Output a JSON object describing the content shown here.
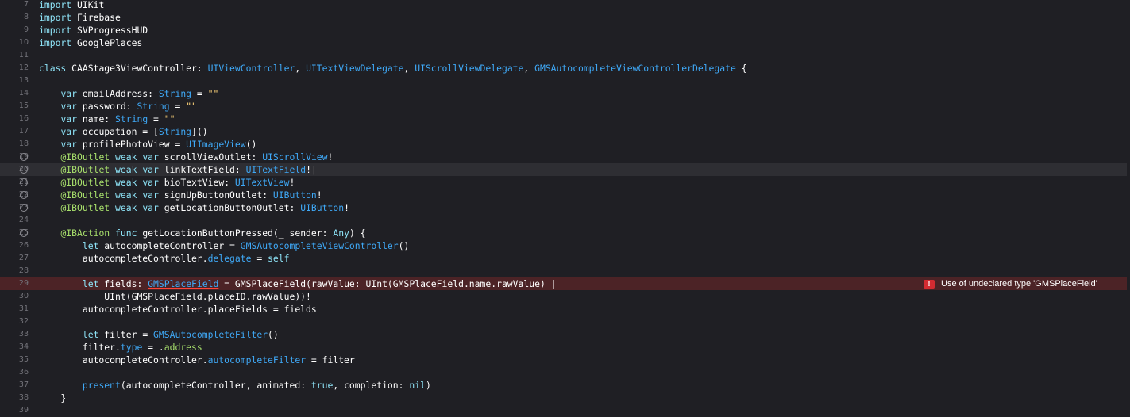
{
  "editor": {
    "lines": [
      {
        "num": "7",
        "tokens": [
          {
            "t": "keyword",
            "v": "import"
          },
          {
            "t": "plain",
            "v": " UIKit"
          }
        ]
      },
      {
        "num": "8",
        "tokens": [
          {
            "t": "keyword",
            "v": "import"
          },
          {
            "t": "plain",
            "v": " Firebase"
          }
        ]
      },
      {
        "num": "9",
        "tokens": [
          {
            "t": "keyword",
            "v": "import"
          },
          {
            "t": "plain",
            "v": " SVProgressHUD"
          }
        ]
      },
      {
        "num": "10",
        "tokens": [
          {
            "t": "keyword",
            "v": "import"
          },
          {
            "t": "plain",
            "v": " GooglePlaces"
          }
        ]
      },
      {
        "num": "11",
        "tokens": []
      },
      {
        "num": "12",
        "tokens": [
          {
            "t": "keyword",
            "v": "class"
          },
          {
            "t": "plain",
            "v": " CAAStage3ViewController: "
          },
          {
            "t": "type",
            "v": "UIViewController"
          },
          {
            "t": "plain",
            "v": ", "
          },
          {
            "t": "type",
            "v": "UITextViewDelegate"
          },
          {
            "t": "plain",
            "v": ", "
          },
          {
            "t": "type",
            "v": "UIScrollViewDelegate"
          },
          {
            "t": "plain",
            "v": ", "
          },
          {
            "t": "type",
            "v": "GMSAutocompleteViewControllerDelegate"
          },
          {
            "t": "plain",
            "v": " {"
          }
        ]
      },
      {
        "num": "13",
        "tokens": []
      },
      {
        "num": "14",
        "tokens": [
          {
            "t": "plain",
            "v": "    "
          },
          {
            "t": "keyword",
            "v": "var"
          },
          {
            "t": "plain",
            "v": " emailAddress: "
          },
          {
            "t": "type",
            "v": "String"
          },
          {
            "t": "plain",
            "v": " = "
          },
          {
            "t": "string",
            "v": "\"\""
          }
        ]
      },
      {
        "num": "15",
        "tokens": [
          {
            "t": "plain",
            "v": "    "
          },
          {
            "t": "keyword",
            "v": "var"
          },
          {
            "t": "plain",
            "v": " password: "
          },
          {
            "t": "type",
            "v": "String"
          },
          {
            "t": "plain",
            "v": " = "
          },
          {
            "t": "string",
            "v": "\"\""
          }
        ]
      },
      {
        "num": "16",
        "tokens": [
          {
            "t": "plain",
            "v": "    "
          },
          {
            "t": "keyword",
            "v": "var"
          },
          {
            "t": "plain",
            "v": " name: "
          },
          {
            "t": "type",
            "v": "String"
          },
          {
            "t": "plain",
            "v": " = "
          },
          {
            "t": "string",
            "v": "\"\""
          }
        ]
      },
      {
        "num": "17",
        "tokens": [
          {
            "t": "plain",
            "v": "    "
          },
          {
            "t": "keyword",
            "v": "var"
          },
          {
            "t": "plain",
            "v": " occupation = ["
          },
          {
            "t": "type",
            "v": "String"
          },
          {
            "t": "plain",
            "v": "]()"
          }
        ]
      },
      {
        "num": "18",
        "tokens": [
          {
            "t": "plain",
            "v": "    "
          },
          {
            "t": "keyword",
            "v": "var"
          },
          {
            "t": "plain",
            "v": " profilePhotoView = "
          },
          {
            "t": "type",
            "v": "UIImageView"
          },
          {
            "t": "plain",
            "v": "()"
          }
        ]
      },
      {
        "num": "19",
        "marker": true,
        "tokens": [
          {
            "t": "plain",
            "v": "    "
          },
          {
            "t": "attr",
            "v": "@IBOutlet"
          },
          {
            "t": "plain",
            "v": " "
          },
          {
            "t": "keyword",
            "v": "weak"
          },
          {
            "t": "plain",
            "v": " "
          },
          {
            "t": "keyword",
            "v": "var"
          },
          {
            "t": "plain",
            "v": " scrollViewOutlet: "
          },
          {
            "t": "type",
            "v": "UIScrollView"
          },
          {
            "t": "plain",
            "v": "!"
          }
        ]
      },
      {
        "num": "20",
        "marker": true,
        "current": true,
        "tokens": [
          {
            "t": "plain",
            "v": "    "
          },
          {
            "t": "attr",
            "v": "@IBOutlet"
          },
          {
            "t": "plain",
            "v": " "
          },
          {
            "t": "keyword",
            "v": "weak"
          },
          {
            "t": "plain",
            "v": " "
          },
          {
            "t": "keyword",
            "v": "var"
          },
          {
            "t": "plain",
            "v": " linkTextField: "
          },
          {
            "t": "type",
            "v": "UITextField"
          },
          {
            "t": "plain",
            "v": "!"
          },
          {
            "t": "cursor",
            "v": "|"
          }
        ]
      },
      {
        "num": "21",
        "marker": true,
        "tokens": [
          {
            "t": "plain",
            "v": "    "
          },
          {
            "t": "attr",
            "v": "@IBOutlet"
          },
          {
            "t": "plain",
            "v": " "
          },
          {
            "t": "keyword",
            "v": "weak"
          },
          {
            "t": "plain",
            "v": " "
          },
          {
            "t": "keyword",
            "v": "var"
          },
          {
            "t": "plain",
            "v": " bioTextView: "
          },
          {
            "t": "type",
            "v": "UITextView"
          },
          {
            "t": "plain",
            "v": "!"
          }
        ]
      },
      {
        "num": "22",
        "marker": true,
        "tokens": [
          {
            "t": "plain",
            "v": "    "
          },
          {
            "t": "attr",
            "v": "@IBOutlet"
          },
          {
            "t": "plain",
            "v": " "
          },
          {
            "t": "keyword",
            "v": "weak"
          },
          {
            "t": "plain",
            "v": " "
          },
          {
            "t": "keyword",
            "v": "var"
          },
          {
            "t": "plain",
            "v": " signUpButtonOutlet: "
          },
          {
            "t": "type",
            "v": "UIButton"
          },
          {
            "t": "plain",
            "v": "!"
          }
        ]
      },
      {
        "num": "23",
        "marker": true,
        "tokens": [
          {
            "t": "plain",
            "v": "    "
          },
          {
            "t": "attr",
            "v": "@IBOutlet"
          },
          {
            "t": "plain",
            "v": " "
          },
          {
            "t": "keyword",
            "v": "weak"
          },
          {
            "t": "plain",
            "v": " "
          },
          {
            "t": "keyword",
            "v": "var"
          },
          {
            "t": "plain",
            "v": " getLocationButtonOutlet: "
          },
          {
            "t": "type",
            "v": "UIButton"
          },
          {
            "t": "plain",
            "v": "!"
          }
        ]
      },
      {
        "num": "24",
        "tokens": []
      },
      {
        "num": "25",
        "marker": true,
        "tokens": [
          {
            "t": "plain",
            "v": "    "
          },
          {
            "t": "attr",
            "v": "@IBAction"
          },
          {
            "t": "plain",
            "v": " "
          },
          {
            "t": "keyword",
            "v": "func"
          },
          {
            "t": "plain",
            "v": " getLocationButtonPressed(_ sender: "
          },
          {
            "t": "keyword",
            "v": "Any"
          },
          {
            "t": "plain",
            "v": ") {"
          }
        ]
      },
      {
        "num": "26",
        "tokens": [
          {
            "t": "plain",
            "v": "        "
          },
          {
            "t": "keyword",
            "v": "let"
          },
          {
            "t": "plain",
            "v": " autocompleteController = "
          },
          {
            "t": "type",
            "v": "GMSAutocompleteViewController"
          },
          {
            "t": "plain",
            "v": "()"
          }
        ]
      },
      {
        "num": "27",
        "tokens": [
          {
            "t": "plain",
            "v": "        autocompleteController."
          },
          {
            "t": "prop",
            "v": "delegate"
          },
          {
            "t": "plain",
            "v": " = "
          },
          {
            "t": "keyword",
            "v": "self"
          }
        ]
      },
      {
        "num": "28",
        "tokens": []
      },
      {
        "num": "29",
        "error": true,
        "tokens": [
          {
            "t": "plain",
            "v": "        "
          },
          {
            "t": "keyword",
            "v": "let"
          },
          {
            "t": "plain",
            "v": " fields: "
          },
          {
            "t": "err",
            "v": "GMSPlaceField"
          },
          {
            "t": "plain",
            "v": " = GMSPlaceField(rawValue: UInt(GMSPlaceField.name.rawValue) |"
          }
        ]
      },
      {
        "num": "30",
        "tokens": [
          {
            "t": "plain",
            "v": "            UInt(GMSPlaceField.placeID.rawValue))!"
          }
        ]
      },
      {
        "num": "31",
        "tokens": [
          {
            "t": "plain",
            "v": "        autocompleteController.placeFields = fields"
          }
        ]
      },
      {
        "num": "32",
        "tokens": []
      },
      {
        "num": "33",
        "tokens": [
          {
            "t": "plain",
            "v": "        "
          },
          {
            "t": "keyword",
            "v": "let"
          },
          {
            "t": "plain",
            "v": " filter = "
          },
          {
            "t": "type",
            "v": "GMSAutocompleteFilter"
          },
          {
            "t": "plain",
            "v": "()"
          }
        ]
      },
      {
        "num": "34",
        "tokens": [
          {
            "t": "plain",
            "v": "        filter."
          },
          {
            "t": "prop",
            "v": "type"
          },
          {
            "t": "plain",
            "v": " = ."
          },
          {
            "t": "enum",
            "v": "address"
          }
        ]
      },
      {
        "num": "35",
        "tokens": [
          {
            "t": "plain",
            "v": "        autocompleteController."
          },
          {
            "t": "prop",
            "v": "autocompleteFilter"
          },
          {
            "t": "plain",
            "v": " = filter"
          }
        ]
      },
      {
        "num": "36",
        "tokens": []
      },
      {
        "num": "37",
        "tokens": [
          {
            "t": "plain",
            "v": "        "
          },
          {
            "t": "prop",
            "v": "present"
          },
          {
            "t": "plain",
            "v": "(autocompleteController, animated: "
          },
          {
            "t": "keyword",
            "v": "true"
          },
          {
            "t": "plain",
            "v": ", completion: "
          },
          {
            "t": "keyword",
            "v": "nil"
          },
          {
            "t": "plain",
            "v": ")"
          }
        ]
      },
      {
        "num": "38",
        "tokens": [
          {
            "t": "plain",
            "v": "    }"
          }
        ]
      },
      {
        "num": "39",
        "tokens": []
      }
    ]
  },
  "error_annotation": {
    "icon": "!",
    "message": "Use of undeclared type 'GMSPlaceField'"
  },
  "colors": {
    "background": "#1f1f24",
    "keyword": "#8ee3f7",
    "type": "#3fa9f7",
    "string": "#ffd479",
    "attribute": "#a8e06c",
    "error_line": "#4c2326",
    "error_badge": "#d42b31"
  }
}
